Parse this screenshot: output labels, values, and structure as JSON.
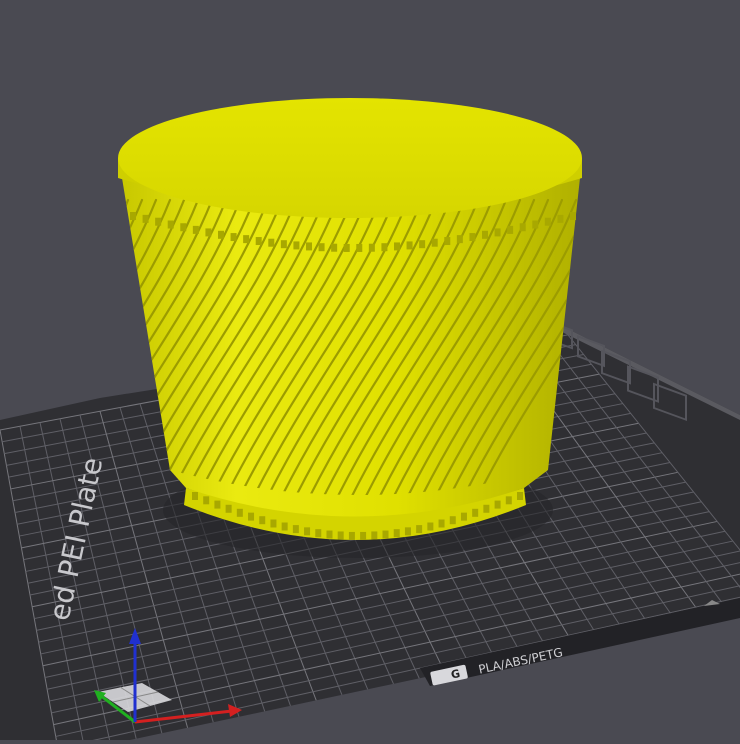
{
  "viewport": {
    "background": "#4a4a52",
    "bed": {
      "surface_color": "#2f2f33",
      "grid_color": "#6a6a70",
      "plate_label": "ed PEI Plate",
      "material_label": "PLA/ABS/PETG",
      "badge_text": "G"
    },
    "model": {
      "color": "#dede00"
    },
    "axes": {
      "x_color": "#d42020",
      "y_color": "#20b020",
      "z_color": "#2030d0"
    },
    "plate_toolbar_icons": [
      "plate-arrange-icon",
      "plate-orient-icon",
      "plate-settings-icon",
      "plate-lock-icon",
      "plate-view-icon"
    ]
  }
}
